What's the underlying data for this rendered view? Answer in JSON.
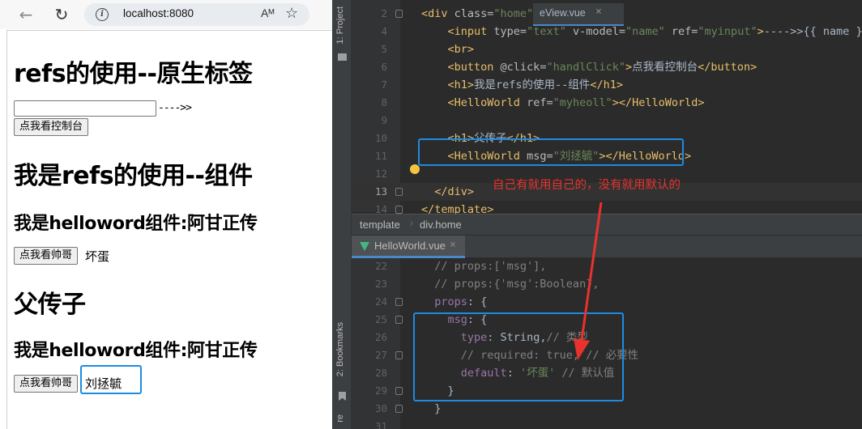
{
  "browser": {
    "url": "localhost:8080",
    "read_aloud_label": "Aᴹ",
    "icons": {
      "back": "back-arrow-icon",
      "reload": "reload-icon",
      "info": "info-icon",
      "favorite": "star-icon"
    }
  },
  "page": {
    "h1_refs_native": "refs的使用--原生标签",
    "input_value": "",
    "arrow_text": "---->>",
    "console_button": "点我看控制台",
    "h1_refs_component": "我是refs的使用--组件",
    "hw1_heading": "我是helloword组件:阿甘正传",
    "hw1_button": "点我看帅哥",
    "hw1_msg": "坏蛋",
    "h1_father_child": "父传子",
    "hw2_heading": "我是helloword组件:阿甘正传",
    "hw2_button": "点我看帅哥",
    "hw2_msg": "刘拯毓"
  },
  "ide": {
    "side_tabs": {
      "project": "1: Project",
      "bookmarks": "2: Bookmarks",
      "structure": "re"
    },
    "top_tab_fragment": "eView.vue",
    "breadcrumb": [
      "template",
      "div.home"
    ],
    "bottom_tab": "HelloWorld.vue",
    "annotation": "自己有就用自己的，没有就用默认的",
    "accent_color": "#1d8ce0",
    "annotation_color": "#e8322d",
    "top_lines": [
      {
        "n": "2",
        "tokens": [
          [
            "t-tag",
            "<div "
          ],
          [
            "t-attr",
            "class="
          ],
          [
            "t-str",
            "\"home\""
          ],
          [
            "t-tag",
            ">"
          ]
        ]
      },
      {
        "n": "4",
        "tokens": [
          [
            "t-text",
            "    "
          ],
          [
            "t-tag",
            "<input "
          ],
          [
            "t-attr",
            "type="
          ],
          [
            "t-str",
            "\"text\" "
          ],
          [
            "t-attr",
            "v-model="
          ],
          [
            "t-str",
            "\"name\" "
          ],
          [
            "t-attr",
            "ref="
          ],
          [
            "t-str",
            "\"myinput\""
          ],
          [
            "t-tag",
            ">"
          ],
          [
            "t-text",
            "---->>{{ name }}"
          ]
        ]
      },
      {
        "n": "5",
        "tokens": [
          [
            "t-text",
            "    "
          ],
          [
            "t-tag",
            "<br>"
          ]
        ]
      },
      {
        "n": "6",
        "tokens": [
          [
            "t-text",
            "    "
          ],
          [
            "t-tag",
            "<button "
          ],
          [
            "t-attr",
            "@click="
          ],
          [
            "t-str",
            "\"handlClick\""
          ],
          [
            "t-tag",
            ">"
          ],
          [
            "t-text",
            "点我看控制台"
          ],
          [
            "t-tag",
            "</button>"
          ]
        ]
      },
      {
        "n": "7",
        "tokens": [
          [
            "t-text",
            "    "
          ],
          [
            "t-tag",
            "<h1>"
          ],
          [
            "t-text",
            "我是refs的使用--组件"
          ],
          [
            "t-tag",
            "</h1>"
          ]
        ]
      },
      {
        "n": "8",
        "tokens": [
          [
            "t-text",
            "    "
          ],
          [
            "t-tag",
            "<HelloWorld "
          ],
          [
            "t-attr",
            "ref="
          ],
          [
            "t-str",
            "\"myheoll\""
          ],
          [
            "t-tag",
            "></HelloWorld>"
          ]
        ]
      },
      {
        "n": "9",
        "tokens": []
      },
      {
        "n": "10",
        "tokens": [
          [
            "t-text",
            "    "
          ],
          [
            "t-tag",
            "<h1>"
          ],
          [
            "t-text",
            "父传子"
          ],
          [
            "t-tag",
            "</h1>"
          ]
        ]
      },
      {
        "n": "11",
        "tokens": [
          [
            "t-text",
            "    "
          ],
          [
            "t-tag",
            "<HelloWorld "
          ],
          [
            "t-attr",
            "msg="
          ],
          [
            "t-str",
            "\"刘拯毓\""
          ],
          [
            "t-tag",
            "></HelloWorld>"
          ]
        ]
      },
      {
        "n": "12",
        "tokens": []
      },
      {
        "n": "13",
        "tokens": [
          [
            "t-text",
            "  "
          ],
          [
            "t-tag",
            "</div>"
          ]
        ]
      },
      {
        "n": "14",
        "tokens": [
          [
            "t-tag",
            "</template>"
          ]
        ]
      }
    ],
    "bottom_lines": [
      {
        "n": "22",
        "tokens": [
          [
            "t-cmt",
            "  // props:['msg'],"
          ]
        ]
      },
      {
        "n": "23",
        "tokens": [
          [
            "t-cmt",
            "  // props:{'msg':Boolean},"
          ]
        ]
      },
      {
        "n": "24",
        "tokens": [
          [
            "t-text",
            "  "
          ],
          [
            "t-key",
            "props"
          ],
          [
            "t-text",
            ": {"
          ]
        ]
      },
      {
        "n": "25",
        "tokens": [
          [
            "t-text",
            "    "
          ],
          [
            "t-key",
            "msg"
          ],
          [
            "t-text",
            ": {"
          ]
        ]
      },
      {
        "n": "26",
        "tokens": [
          [
            "t-text",
            "      "
          ],
          [
            "t-key",
            "type"
          ],
          [
            "t-text",
            ": String,"
          ],
          [
            "t-cmt",
            "// 类型"
          ]
        ]
      },
      {
        "n": "27",
        "tokens": [
          [
            "t-cmt",
            "      // required: true, // 必要性"
          ]
        ]
      },
      {
        "n": "28",
        "tokens": [
          [
            "t-text",
            "      "
          ],
          [
            "t-key",
            "default"
          ],
          [
            "t-text",
            ": "
          ],
          [
            "t-str",
            "'坏蛋'"
          ],
          [
            "t-text",
            " "
          ],
          [
            "t-cmt",
            "// 默认值"
          ]
        ]
      },
      {
        "n": "29",
        "tokens": [
          [
            "t-text",
            "    }"
          ]
        ]
      },
      {
        "n": "30",
        "tokens": [
          [
            "t-text",
            "  }"
          ]
        ]
      },
      {
        "n": "31",
        "tokens": []
      }
    ]
  }
}
